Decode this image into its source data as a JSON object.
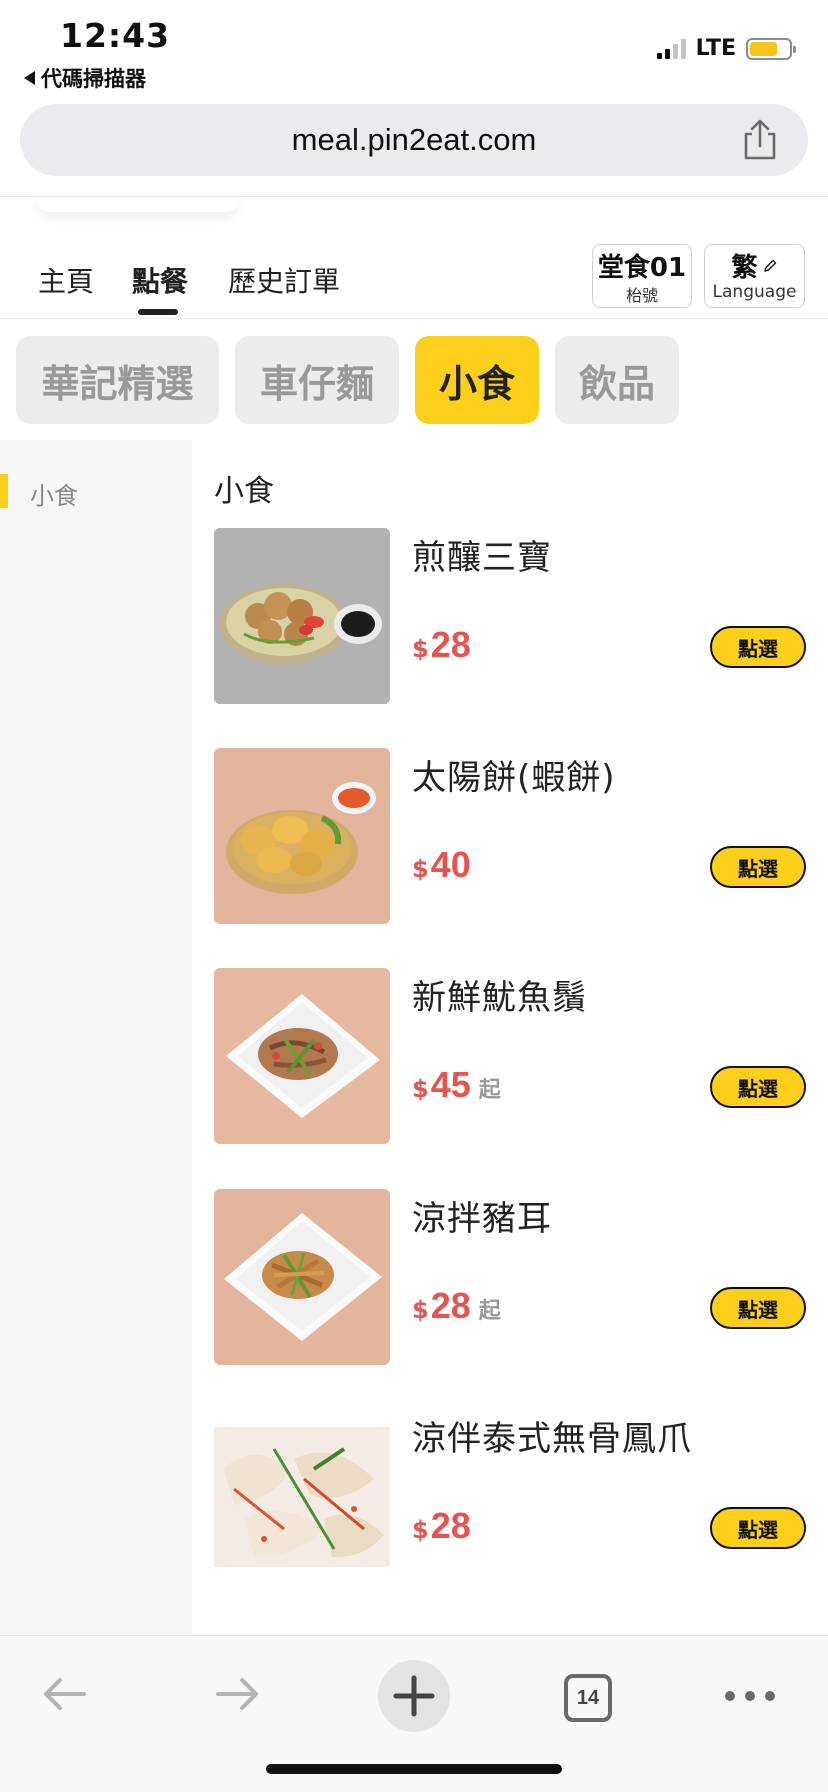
{
  "status_bar": {
    "time": "12:43",
    "back_app": "代碼掃描器",
    "network": "LTE"
  },
  "browser": {
    "url": "meal.pin2eat.com",
    "tab_count": "14"
  },
  "nav": {
    "tabs": [
      {
        "label": "主頁"
      },
      {
        "label": "點餐"
      },
      {
        "label": "歷史訂單"
      }
    ],
    "active_tab": "點餐",
    "table_main": "堂食01",
    "table_sub": "枱號",
    "lang_main": "繁",
    "lang_sub": "Language"
  },
  "categories": [
    {
      "label": "華記精選"
    },
    {
      "label": "車仔麵"
    },
    {
      "label": "小食"
    },
    {
      "label": "飲品"
    }
  ],
  "active_category": "小食",
  "sidebar": {
    "items": [
      {
        "label": "小食"
      }
    ]
  },
  "menu": {
    "section_title": "小食",
    "currency": "$",
    "from_label": "起",
    "select_label": "點選",
    "items": [
      {
        "name": "煎釀三寶",
        "price": "28",
        "from": ""
      },
      {
        "name": "太陽餅(蝦餅)",
        "price": "40",
        "from": ""
      },
      {
        "name": "新鮮魷魚鬚",
        "price": "45",
        "from": "起"
      },
      {
        "name": "涼拌豬耳",
        "price": "28",
        "from": "起"
      },
      {
        "name": "涼伴泰式無骨鳳爪",
        "price": "28",
        "from": ""
      }
    ]
  },
  "colors": {
    "accent_yellow": "#fccf1a",
    "price_red": "#e4554f",
    "pill_gray": "#ececec"
  }
}
